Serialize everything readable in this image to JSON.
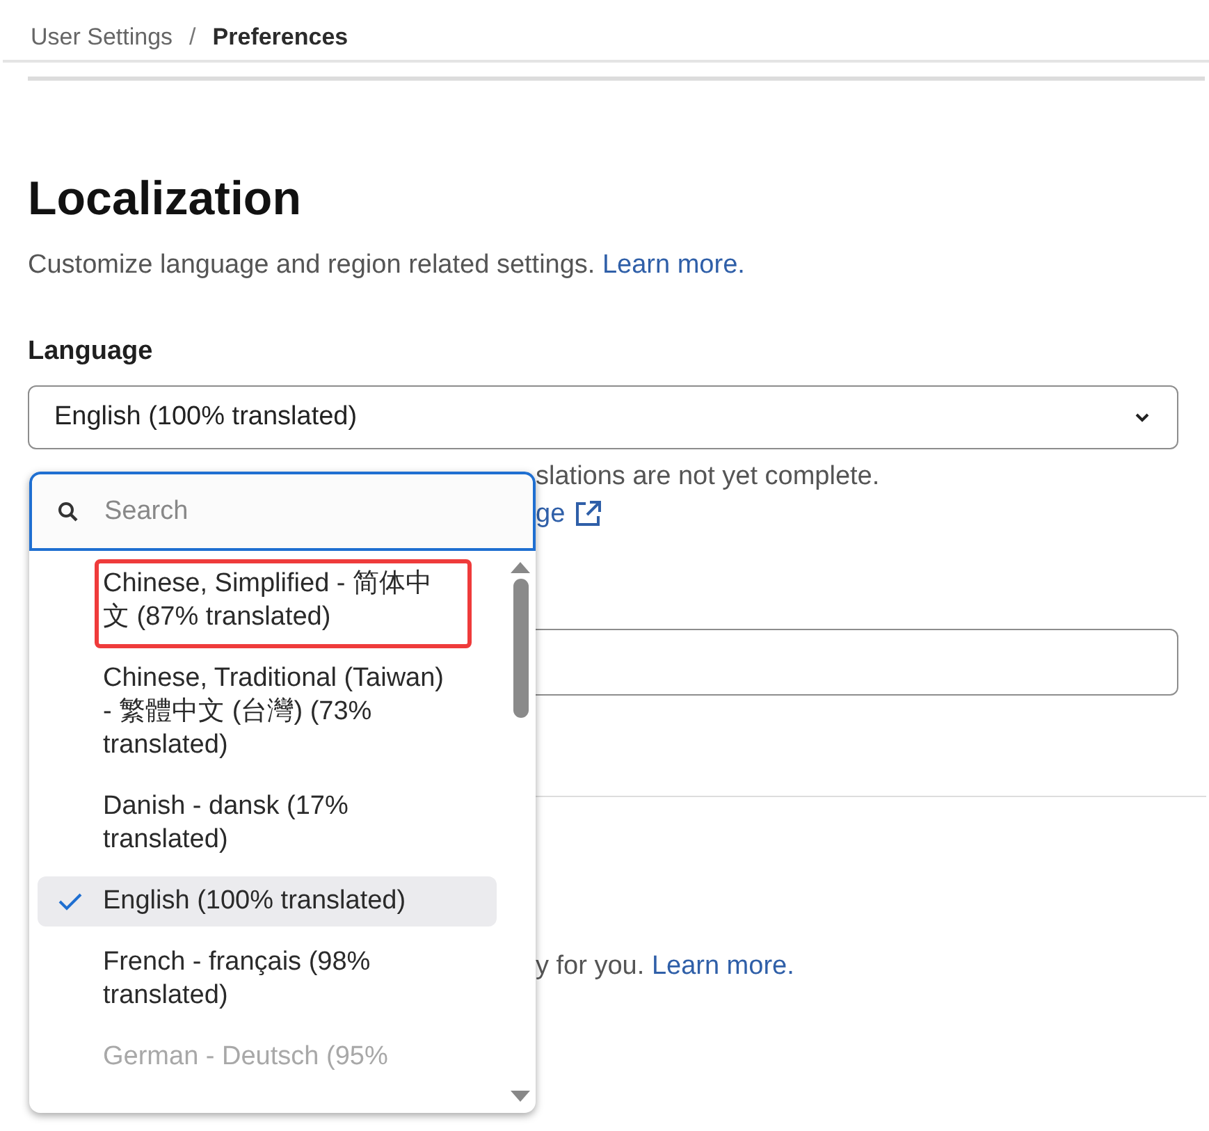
{
  "breadcrumb": [
    {
      "label": "User Settings",
      "current": false
    },
    {
      "label": "Preferences",
      "current": true
    }
  ],
  "breadcrumb_separator": "/",
  "heading": "Localization",
  "description": {
    "text": "Customize language and region related settings.",
    "link": "Learn more."
  },
  "language": {
    "label": "Language",
    "value": "English (100% translated)"
  },
  "covered": {
    "helper_fragment": "slations are not yet complete.",
    "link_fragment": "ge",
    "text_fragment": "y for you.",
    "link": "Learn more."
  },
  "dropdown": {
    "search": {
      "placeholder": "Search"
    },
    "options": [
      {
        "label": "Chinese, Simplified - 简体中文 (87% translated)",
        "selected": false,
        "annotated": true,
        "faded": false
      },
      {
        "label": "Chinese, Traditional (Taiwan) - 繁體中文 (台灣) (73% translated)",
        "selected": false,
        "annotated": false,
        "faded": false
      },
      {
        "label": "Danish - dansk (17% translated)",
        "selected": false,
        "annotated": false,
        "faded": false
      },
      {
        "label": "English (100% translated)",
        "selected": true,
        "annotated": false,
        "faded": false
      },
      {
        "label": "French - français (98% translated)",
        "selected": false,
        "annotated": false,
        "faded": false
      },
      {
        "label": "German - Deutsch (95%",
        "selected": false,
        "annotated": false,
        "faded": true
      }
    ]
  }
}
